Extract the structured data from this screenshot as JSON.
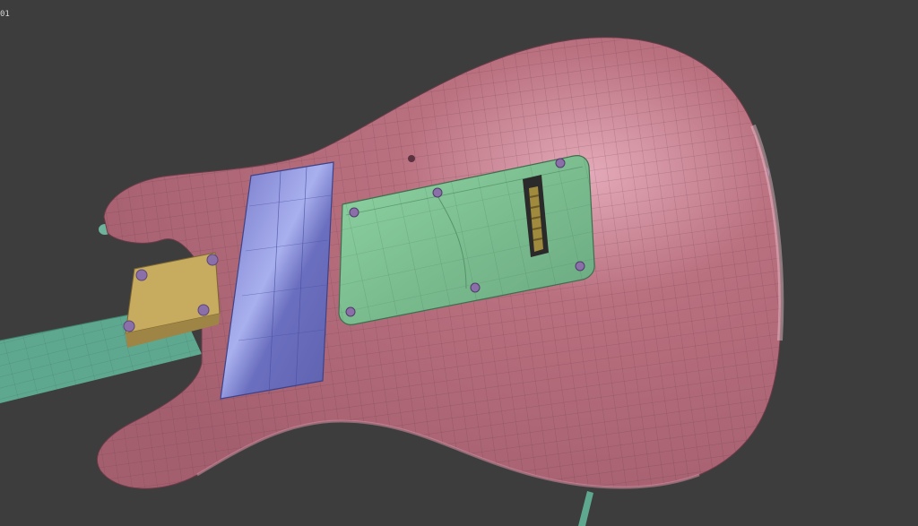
{
  "viewport": {
    "frame_label": "01"
  },
  "scene": {
    "background": "#3d3d3d",
    "body_color": "#b8707f",
    "neck_color": "#5fa890",
    "pickguard_color": "#7c7fc9",
    "backplate_color": "#7fbf92",
    "neckplate_color": "#c4a85c",
    "screw_color": "#8a6fa8"
  }
}
